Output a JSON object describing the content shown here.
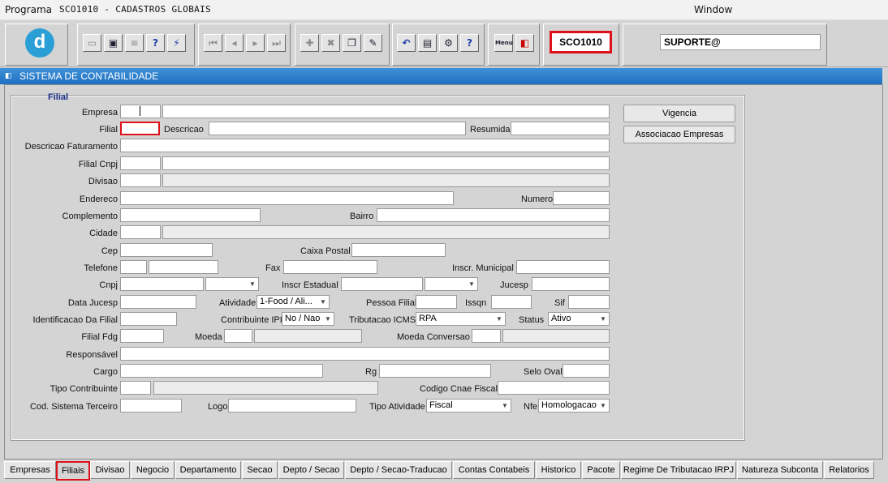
{
  "menubar": {
    "program": "Programa",
    "module": "SCO1010 - CADASTROS GLOBAIS",
    "window": "Window"
  },
  "toolbar": {
    "code": "SCO1010",
    "user": "SUPORTE@",
    "logo_letter": "d",
    "icons": {
      "save": "save-icon",
      "clear": "clear-form-icon",
      "print": "print-icon",
      "query": "enter-query-icon",
      "execute": "execute-query-icon",
      "first": "first-record-icon",
      "prev": "previous-record-icon",
      "next": "next-record-icon",
      "last": "last-record-icon",
      "insert": "insert-record-icon",
      "delete": "delete-record-icon",
      "duplicate": "duplicate-record-icon",
      "edit": "edit-icon",
      "undo": "undo-icon",
      "list": "list-values-icon",
      "tools": "tools-icon",
      "help": "help-icon",
      "menu": "menu-icon",
      "exit": "exit-icon"
    },
    "glyphs": {
      "undo": "↶",
      "list": "▤",
      "help": "?",
      "menu": "Menu",
      "exit": "◧"
    }
  },
  "sysbar": {
    "title": "SISTEMA DE CONTABILIDADE"
  },
  "form": {
    "section_title": "Filial",
    "labels": {
      "empresa": "Empresa",
      "filial": "Filial",
      "descricao": "Descricao",
      "resumida": "Resumida",
      "descricao_faturamento": "Descricao Faturamento",
      "filial_cnpj": "Filial Cnpj",
      "divisao": "Divisao",
      "endereco": "Endereco",
      "numero": "Numero",
      "complemento": "Complemento",
      "bairro": "Bairro",
      "cidade": "Cidade",
      "cep": "Cep",
      "caixa_postal": "Caixa Postal",
      "telefone": "Telefone",
      "fax": "Fax",
      "inscr_municipal": "Inscr. Municipal",
      "cnpj": "Cnpj",
      "inscr_estadual": "Inscr Estadual",
      "jucesp": "Jucesp",
      "data_jucesp": "Data Jucesp",
      "atividade": "Atividade",
      "pessoa_filial": "Pessoa Filial",
      "issqn": "Issqn",
      "sif": "Sif",
      "identificacao_filial": "Identificacao Da Filial",
      "contribuinte_ipi": "Contribuinte IPI",
      "tributacao_icms": "Tributacao ICMS",
      "status": "Status",
      "filial_fdg": "Filial Fdg",
      "moeda": "Moeda",
      "moeda_conversao": "Moeda Conversao",
      "responsavel": "Responsável",
      "cargo": "Cargo",
      "rg": "Rg",
      "selo_oval": "Selo Oval",
      "tipo_contribuinte": "Tipo Contribuinte",
      "codigo_cnae_fiscal": "Codigo Cnae Fiscal",
      "cod_sistema_terceiro": "Cod. Sistema Terceiro",
      "logo": "Logo",
      "tipo_atividade": "Tipo Atividade",
      "nfe": "Nfe"
    },
    "values": {
      "atividade": "1-Food / Ali...",
      "contribuinte_ipi": "No / Nao",
      "tributacao_icms": "RPA",
      "status": "Ativo",
      "tipo_atividade": "Fiscal",
      "nfe": "Homologacao"
    },
    "buttons": {
      "vigencia": "Vigencia",
      "associacao": "Associacao Empresas"
    }
  },
  "tabs": [
    "Empresas",
    "Filiais",
    "Divisao",
    "Negocio",
    "Departamento",
    "Secao",
    "Depto / Secao",
    "Depto / Secao-Traducao",
    "Contas Contabeis",
    "Historico",
    "Pacote",
    "Regime De Tributacao IRPJ",
    "Natureza Subconta",
    "Relatorios"
  ],
  "active_tab": "Filiais",
  "colors": {
    "accent": "#e0101a",
    "sysbar": "#2f7fcc",
    "section_title": "#1a2f8a"
  }
}
